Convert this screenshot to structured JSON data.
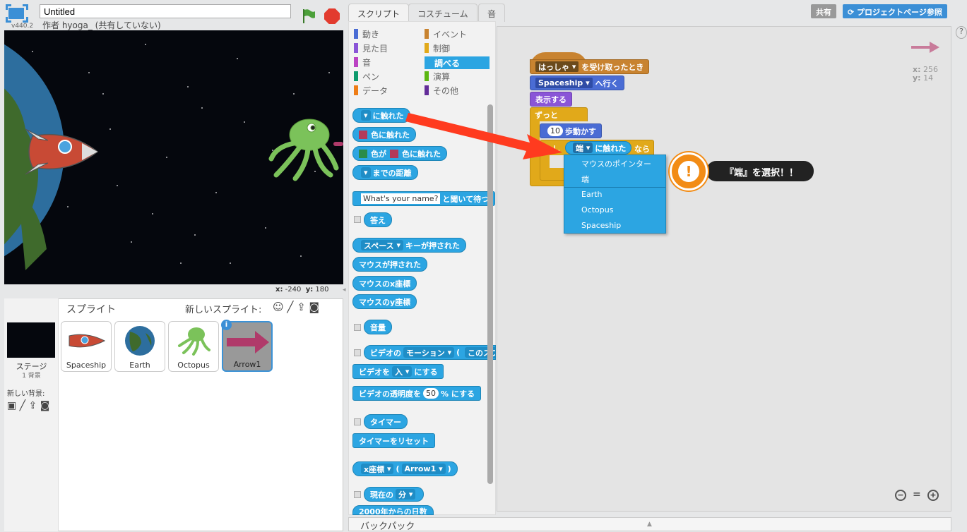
{
  "header": {
    "version": "v440.2",
    "title": "Untitled",
    "author": "作者 hyoga_ (共有していない)"
  },
  "stage": {
    "x_label": "x:",
    "x_value": "-240",
    "y_label": "y:",
    "y_value": "180"
  },
  "sprites": {
    "header": "スプライト",
    "new_sprite": "新しいスプライト:",
    "stage_label": "ステージ",
    "stage_sub": "1 背景",
    "new_backdrop": "新しい背景:",
    "items": [
      {
        "name": "Spaceship"
      },
      {
        "name": "Earth"
      },
      {
        "name": "Octopus"
      },
      {
        "name": "Arrow1"
      }
    ]
  },
  "tabs": [
    "スクリプト",
    "コスチューム",
    "音"
  ],
  "categories": [
    {
      "label": "動き",
      "color": "#4a6cd4"
    },
    {
      "label": "イベント",
      "color": "#c88330"
    },
    {
      "label": "見た目",
      "color": "#8a55d7"
    },
    {
      "label": "制御",
      "color": "#e1a91a"
    },
    {
      "label": "音",
      "color": "#bb42c3"
    },
    {
      "label": "調べる",
      "color": "#2ca5e2"
    },
    {
      "label": "ペン",
      "color": "#0e9a6c"
    },
    {
      "label": "演算",
      "color": "#5cb712"
    },
    {
      "label": "データ",
      "color": "#ee7d16"
    },
    {
      "label": "その他",
      "color": "#632d99"
    }
  ],
  "palette": {
    "touching": "に触れた",
    "touching_color": "色に触れた",
    "color_is": "色が",
    "color_touching": "色に触れた",
    "distance": "までの距離",
    "ask_text": "What's your name?",
    "ask_suffix": "と聞いて待つ",
    "answer": "答え",
    "space": "スペース",
    "key_pressed": "キーが押された",
    "mouse_down": "マウスが押された",
    "mouse_x": "マウスのx座標",
    "mouse_y": "マウスのy座標",
    "loudness": "音量",
    "video": "ビデオの",
    "motion": "モーション",
    "paren": "(",
    "this_sprite": "このスプ",
    "video_on_prefix": "ビデオを",
    "video_on_val": "入",
    "video_on_suffix": "にする",
    "transparency": "ビデオの透明度を",
    "transparency_val": "50",
    "transparency_suffix": "% にする",
    "timer": "タイマー",
    "reset_timer": "タイマーをリセット",
    "x_pos": "x座標",
    "arrow1": "Arrow1",
    "current": "現在の",
    "minute": "分",
    "days_since": "2000年からの日数"
  },
  "script": {
    "hat_dd": "はっしゃ",
    "hat_suffix": "を受け取ったとき",
    "goto_dd": "Spaceship",
    "goto_suffix": "へ行く",
    "show": "表示する",
    "forever": "ずっと",
    "move_val": "10",
    "move_suffix": "歩動かす",
    "if_prefix": "もし",
    "if_dd": "端",
    "if_touching": "に触れた",
    "if_then": "なら"
  },
  "menu": {
    "items": [
      "マウスのポインター",
      "端",
      "Earth",
      "Octopus",
      "Spaceship"
    ]
  },
  "tip": {
    "text": "『端』を選択！！",
    "icon": "!"
  },
  "topright": {
    "share": "共有",
    "project_page": "プロジェクトページ参照",
    "help": "?"
  },
  "sprite_info": {
    "x_label": "x:",
    "x": "256",
    "y_label": "y:",
    "y": "14"
  },
  "zoom": {
    "out": "−",
    "reset": "=",
    "in": "+"
  },
  "backpack": "バックパック",
  "colors": {
    "sensing": "#2ca5e2",
    "events": "#c88330",
    "motion": "#4a6cd4",
    "looks": "#8a55d7",
    "control": "#e1a91a",
    "arrow": "#ff3b1f"
  }
}
